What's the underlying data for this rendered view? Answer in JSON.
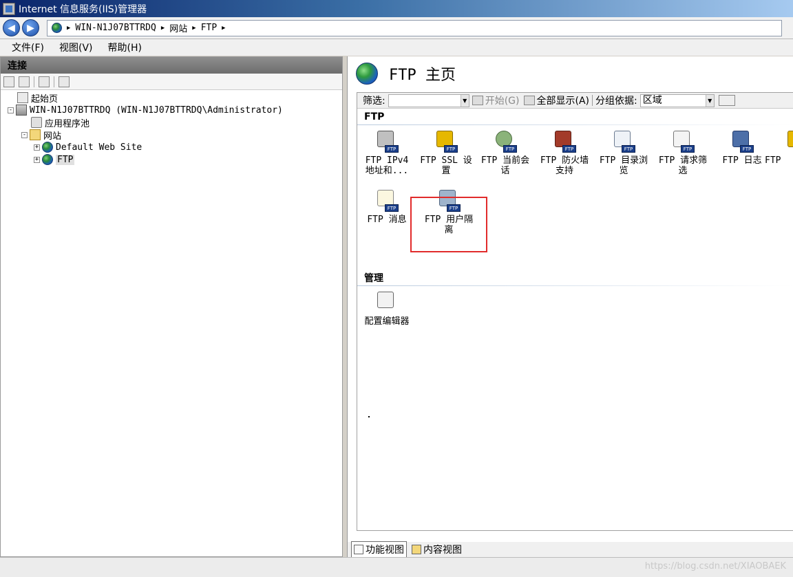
{
  "window": {
    "title": "Internet 信息服务(IIS)管理器"
  },
  "address": {
    "crumbs": [
      "WIN-N1J07BTTRDQ",
      "网站",
      "FTP"
    ]
  },
  "menu": [
    "文件(F)",
    "视图(V)",
    "帮助(H)"
  ],
  "connections": {
    "header": "连接",
    "tree": [
      {
        "label": "起始页",
        "depth": 0,
        "expander": "",
        "icon": "start-page-icon"
      },
      {
        "label": "WIN-N1J07BTTRDQ (WIN-N1J07BTTRDQ\\Administrator)",
        "depth": 0,
        "expander": "-",
        "icon": "server-icon"
      },
      {
        "label": "应用程序池",
        "depth": 1,
        "expander": "",
        "icon": "app-pool-icon"
      },
      {
        "label": "网站",
        "depth": 1,
        "expander": "-",
        "icon": "sites-folder-icon"
      },
      {
        "label": "Default Web Site",
        "depth": 2,
        "expander": "+",
        "icon": "globe-icon"
      },
      {
        "label": "FTP",
        "depth": 2,
        "expander": "+",
        "icon": "globe-icon",
        "selected": true
      }
    ]
  },
  "main": {
    "title": "FTP 主页",
    "filter": {
      "label": "筛选:",
      "start": "开始(G)",
      "show_all": "全部显示(A)",
      "group_by_label": "分组依据:",
      "group_by_value": "区域"
    },
    "sections": [
      {
        "name": "FTP",
        "features": [
          {
            "line1": "FTP IPv4",
            "line2": "地址和...",
            "icon": "ftp-ipv4-icon"
          },
          {
            "line1": "FTP SSL 设",
            "line2": "置",
            "icon": "ftp-ssl-lock-icon"
          },
          {
            "line1": "FTP 当前会",
            "line2": "话",
            "icon": "ftp-sessions-icon"
          },
          {
            "line1": "FTP 防火墙",
            "line2": "支持",
            "icon": "ftp-firewall-icon"
          },
          {
            "line1": "FTP 目录浏",
            "line2": "览",
            "icon": "ftp-directory-browse-icon"
          },
          {
            "line1": "FTP 请求筛",
            "line2": "选",
            "icon": "ftp-request-filter-icon"
          },
          {
            "line1": "FTP 日志",
            "line2": "",
            "icon": "ftp-logging-icon"
          },
          {
            "line1": "FTP",
            "line2": "",
            "icon": "ftp-authorization-icon"
          },
          {
            "line1": "FTP 消息",
            "line2": "",
            "icon": "ftp-messages-icon"
          },
          {
            "line1": "FTP 用户隔",
            "line2": "离",
            "icon": "ftp-user-isolation-icon"
          }
        ]
      },
      {
        "name": "管理",
        "features": [
          {
            "line1": "配置编辑器",
            "line2": "",
            "icon": "config-editor-icon"
          }
        ]
      }
    ],
    "bottom_tabs": [
      "功能视图",
      "内容视图"
    ]
  },
  "watermark": "https://blog.csdn.net/XIAOBAEK"
}
